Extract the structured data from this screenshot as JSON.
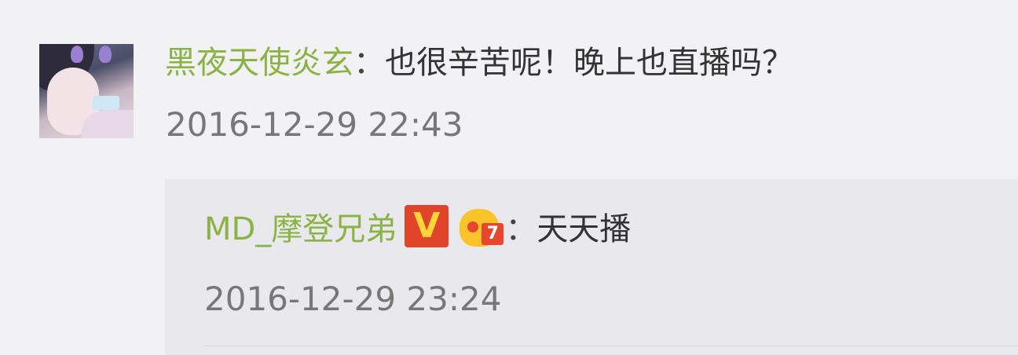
{
  "comment": {
    "username": "黑夜天使炎玄",
    "separator": "：",
    "text": "也很辛苦呢！晚上也直播吗？",
    "timestamp": "2016-12-29 22:43",
    "avatar_icon": "user-avatar"
  },
  "reply": {
    "username": "MD_摩登兄弟",
    "vip_badge": "V",
    "level_badge": "7",
    "separator": "：",
    "text": "天天播",
    "timestamp": "2016-12-29 23:24"
  },
  "colors": {
    "username": "#8bb244",
    "timestamp": "#777777",
    "background": "#f2f2f5",
    "reply_background": "#e9e9ed",
    "vip_badge_bg": "#e0452a",
    "vip_badge_fg": "#ffd43a",
    "crown": "#f9c42a"
  }
}
